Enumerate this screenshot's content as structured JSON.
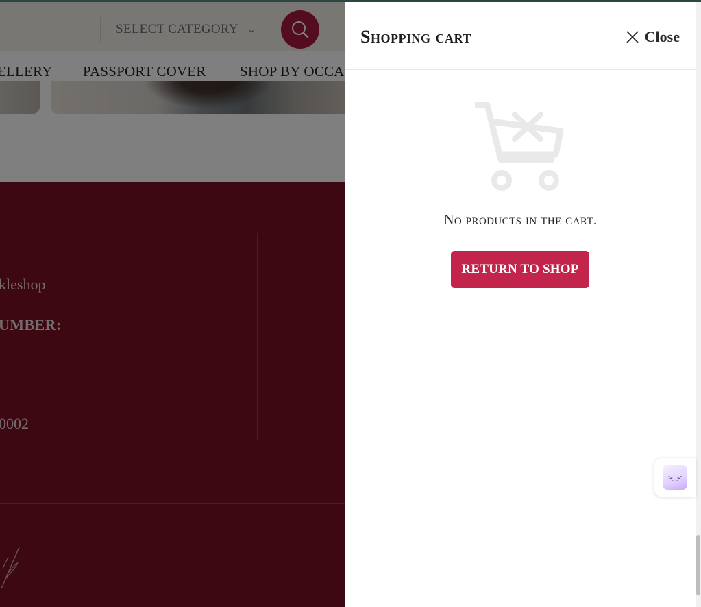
{
  "header": {
    "category_select": {
      "label": "SELECT CATEGORY"
    }
  },
  "nav": {
    "items": [
      {
        "label": "ELLERY"
      },
      {
        "label": "PASSPORT COVER"
      },
      {
        "label": "SHOP BY OCCAS"
      }
    ]
  },
  "footer": {
    "lines": [
      {
        "text": "kleshop"
      },
      {
        "text": "UMBER:"
      },
      {
        "text": "0002"
      }
    ]
  },
  "cart": {
    "title": "Shopping cart",
    "close_label": "Close",
    "empty_message": "No products in the cart.",
    "return_button": "RETURN TO SHOP"
  },
  "chat_widget": {
    "face": ">‿<"
  },
  "colors": {
    "brand": "#c2244b",
    "footer": "#7a1024",
    "search_button": "#a8193f"
  }
}
